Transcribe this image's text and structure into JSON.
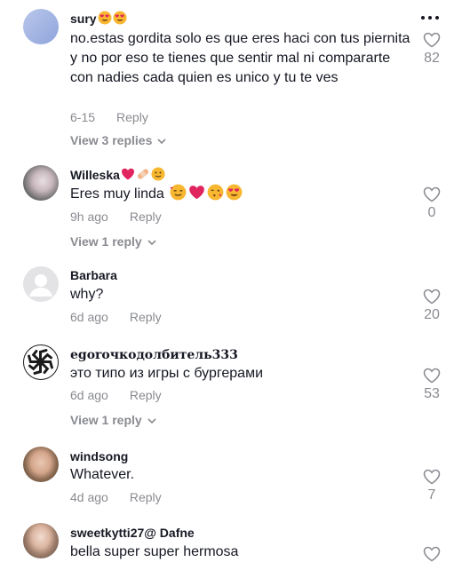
{
  "comments": [
    {
      "username": "sury",
      "text": "no.estas gordita solo es que eres haci con tus piernita y no por eso te tienes que sentir mal ni compararte con nadies cada quien es unico y tu te ves",
      "date": "6-15",
      "reply_label": "Reply",
      "likes": "82",
      "view_replies": "View 3 replies"
    },
    {
      "username": "Willeska",
      "text": "Eres muy linda",
      "date": "9h ago",
      "reply_label": "Reply",
      "likes": "0",
      "view_replies": "View 1 reply"
    },
    {
      "username": "Barbara",
      "text": "why?",
      "date": "6d ago",
      "reply_label": "Reply",
      "likes": "20"
    },
    {
      "username": "egorочкодолбитель333",
      "text": "это типо из игры с бургерами",
      "date": "6d ago",
      "reply_label": "Reply",
      "likes": "53",
      "view_replies": "View 1 reply"
    },
    {
      "username": "windsong",
      "text": "Whatever.",
      "date": "4d ago",
      "reply_label": "Reply",
      "likes": "7"
    },
    {
      "username": "sweetkytti27@ Dafne",
      "text": "bella super super hermosa"
    }
  ],
  "icons": {
    "more": "more-horizontal-icon",
    "like": "heart-outline-icon",
    "chevron": "chevron-down-icon"
  },
  "colors": {
    "text_primary": "#161823",
    "text_secondary": "#8a8b91",
    "emoji_red": "#e0245e",
    "emoji_yellow": "#f7b731"
  }
}
